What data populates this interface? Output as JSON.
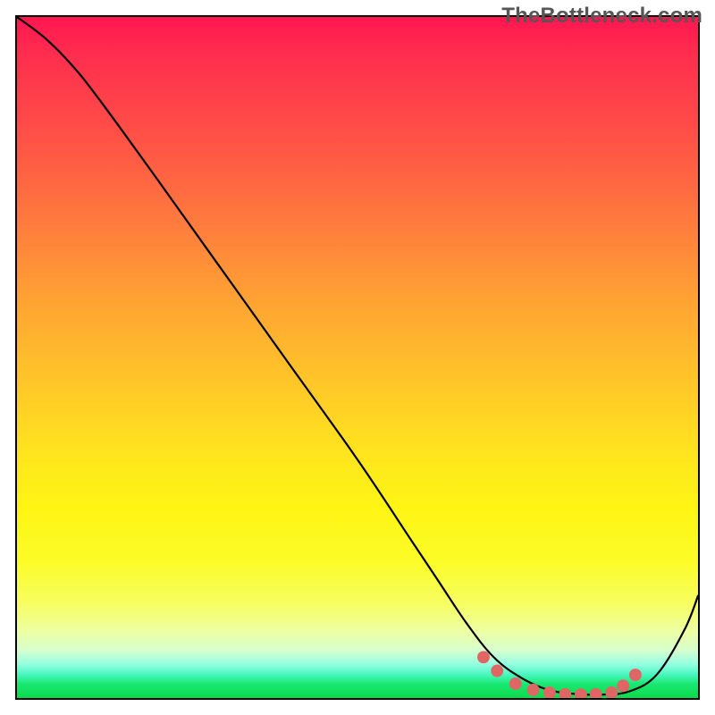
{
  "watermark": "TheBottleneck.com",
  "chart_data": {
    "type": "line",
    "title": "",
    "xlabel": "",
    "ylabel": "",
    "xlim": [
      0,
      100
    ],
    "ylim": [
      0,
      100
    ],
    "series": [
      {
        "name": "bottleneck-curve",
        "x": [
          0,
          4,
          8,
          12,
          20,
          30,
          40,
          50,
          58,
          62,
          66,
          70,
          74,
          78,
          82,
          86,
          90,
          94,
          98,
          100
        ],
        "y": [
          100,
          97,
          93,
          88,
          77,
          63,
          49,
          35,
          23,
          17,
          11,
          6,
          3,
          1.2,
          0.6,
          0.5,
          1.0,
          3.5,
          10,
          15
        ]
      }
    ],
    "markers": {
      "name": "fit-region-dots",
      "x": [
        68.5,
        70.5,
        73.2,
        75.8,
        78.2,
        80.5,
        82.8,
        85.0,
        87.3,
        89.0,
        90.8
      ],
      "y": [
        6.0,
        4.0,
        2.1,
        1.2,
        0.8,
        0.55,
        0.5,
        0.55,
        0.8,
        1.8,
        3.4
      ],
      "color": "#e06666",
      "radius": 7
    },
    "gradient_stops": [
      {
        "pos": 0,
        "color": "#ff1650"
      },
      {
        "pos": 0.3,
        "color": "#ff7a3e"
      },
      {
        "pos": 0.64,
        "color": "#ffe41e"
      },
      {
        "pos": 0.9,
        "color": "#eeffa0"
      },
      {
        "pos": 0.96,
        "color": "#4bf7c0"
      },
      {
        "pos": 1.0,
        "color": "#0bdc4a"
      }
    ]
  }
}
